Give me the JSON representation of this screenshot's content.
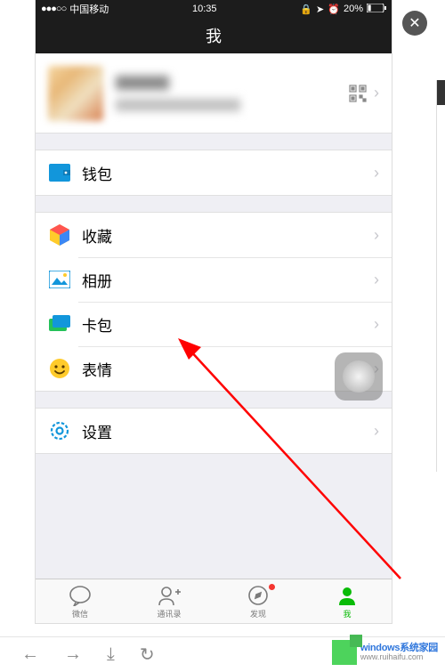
{
  "status": {
    "signal": "●●●○○",
    "carrier": "中国移动",
    "time": "10:35",
    "battery_pct": "20%"
  },
  "nav": {
    "title": "我"
  },
  "menu": {
    "wallet": "钱包",
    "favorites": "收藏",
    "album": "相册",
    "cards": "卡包",
    "stickers": "表情",
    "settings": "设置"
  },
  "tabs": {
    "chats": "微信",
    "contacts": "通讯录",
    "discover": "发现",
    "me": "我"
  },
  "watermark": {
    "line1": "windows系统家园",
    "line2": "www.ruihaifu.com"
  },
  "colors": {
    "accent": "#09bb07",
    "badge": "#f43530",
    "bg": "#efeff4"
  }
}
